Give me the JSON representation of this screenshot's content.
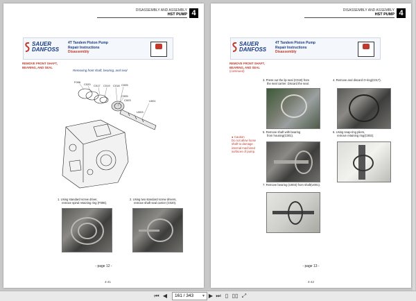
{
  "header": {
    "section": "DISASSEMBLY AND ASSEMBLY",
    "component": "HST PUMP",
    "chapter": "4"
  },
  "banner": {
    "logo_top": "SAUER",
    "logo_bottom": "DANFOSS",
    "title": "4T Tandem Piston Pump",
    "subtitle": "Repair Instructions",
    "section": "Disassembly"
  },
  "left_page": {
    "section_title_1": "REMOVE FRONT SHAFT,",
    "section_title_2": "BEARING, AND SEAL",
    "diagram_caption": "Removing front shaft, bearing, and seal",
    "callouts": [
      "F096",
      "C020",
      "C017",
      "C019",
      "C018",
      "C005",
      "C005",
      "C003",
      "U001",
      "U003"
    ],
    "steps": [
      {
        "num": "1.",
        "text_1": "Using standard screw driver,",
        "text_2": "remove spiral retaining ring (F096)."
      },
      {
        "num": "2.",
        "text_1": "Using two standard screw drivers,",
        "text_2": "remove shaft seal carrier (C020)."
      }
    ],
    "page_label": "- page 12 -",
    "page_number": "4-41"
  },
  "right_page": {
    "section_title_1": "REMOVE FRONT SHAFT,",
    "section_title_2": "BEARING, AND SEAL",
    "continued": "(continued)",
    "caution_1": "Caution",
    "caution_2": "Do not allow loose",
    "caution_3": "shaft to damage",
    "caution_4": "internal machined",
    "caution_5": "surfaces of pump.",
    "steps": [
      {
        "num": "3.",
        "text_1": "Press out the lip seal (C018) from",
        "text_2": "the seal carrier. Discard the seal."
      },
      {
        "num": "4.",
        "text_1": "Remove and discard O-ring(C017).",
        "text_2": ""
      },
      {
        "num": "5.",
        "text_1": "Remove shaft with bearing",
        "text_2": "from housing(C001)."
      },
      {
        "num": "6.",
        "text_1": "Using snap-ring pliers,",
        "text_2": "remove retaining ring(C002)."
      },
      {
        "num": "7.",
        "text_1": "Remove bearing (U003) from shaft(U001).",
        "text_2": ""
      }
    ],
    "page_label": "- page 13 -",
    "page_number": "4-42"
  },
  "toolbar": {
    "first": "⏮",
    "prev": "◀",
    "page_field": "161 / 343",
    "next": "▶",
    "last": "⏭",
    "single_view": "▯",
    "double_view": "▯▯",
    "fit": "⤢"
  }
}
